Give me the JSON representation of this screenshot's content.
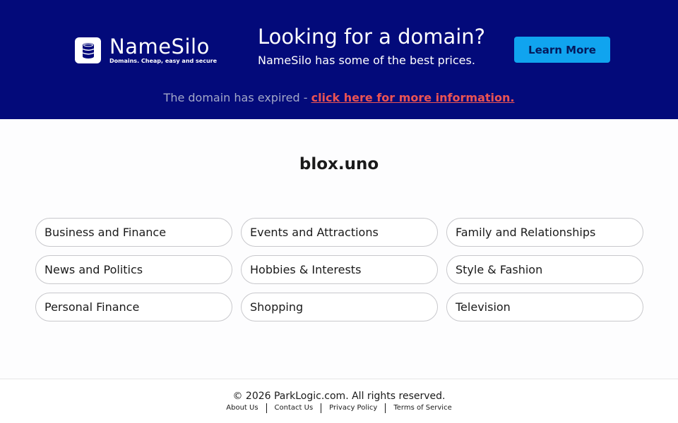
{
  "banner": {
    "logo_name": "NameSilo",
    "logo_tagline": "Domains. Cheap, easy and secure",
    "promo_title": "Looking for a domain?",
    "promo_subtitle": "NameSilo has some of the best prices.",
    "learn_more_label": "Learn More",
    "expired_text": "The domain has expired - ",
    "expired_link": "click here for more information.",
    "colors": {
      "background": "#030a7a",
      "button": "#10a4ef",
      "link": "#ec5353"
    }
  },
  "main": {
    "domain": "blox.uno",
    "categories": [
      "Business and Finance",
      "Events and Attractions",
      "Family and Relationships",
      "News and Politics",
      "Hobbies & Interests",
      "Style & Fashion",
      "Personal Finance",
      "Shopping",
      "Television"
    ]
  },
  "footer": {
    "copyright": "© 2026 ParkLogic.com. All rights reserved.",
    "links": [
      "About Us",
      "Contact Us",
      "Privacy Policy",
      "Terms of Service"
    ]
  }
}
